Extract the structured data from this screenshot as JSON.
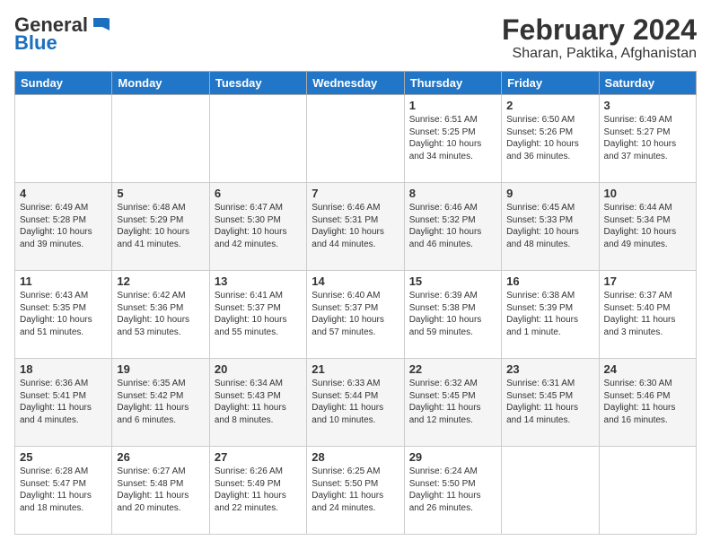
{
  "logo": {
    "general": "General",
    "blue": "Blue"
  },
  "title": "February 2024",
  "subtitle": "Sharan, Paktika, Afghanistan",
  "days": [
    "Sunday",
    "Monday",
    "Tuesday",
    "Wednesday",
    "Thursday",
    "Friday",
    "Saturday"
  ],
  "weeks": [
    [
      {
        "num": "",
        "info": ""
      },
      {
        "num": "",
        "info": ""
      },
      {
        "num": "",
        "info": ""
      },
      {
        "num": "",
        "info": ""
      },
      {
        "num": "1",
        "info": "Sunrise: 6:51 AM\nSunset: 5:25 PM\nDaylight: 10 hours and 34 minutes."
      },
      {
        "num": "2",
        "info": "Sunrise: 6:50 AM\nSunset: 5:26 PM\nDaylight: 10 hours and 36 minutes."
      },
      {
        "num": "3",
        "info": "Sunrise: 6:49 AM\nSunset: 5:27 PM\nDaylight: 10 hours and 37 minutes."
      }
    ],
    [
      {
        "num": "4",
        "info": "Sunrise: 6:49 AM\nSunset: 5:28 PM\nDaylight: 10 hours and 39 minutes."
      },
      {
        "num": "5",
        "info": "Sunrise: 6:48 AM\nSunset: 5:29 PM\nDaylight: 10 hours and 41 minutes."
      },
      {
        "num": "6",
        "info": "Sunrise: 6:47 AM\nSunset: 5:30 PM\nDaylight: 10 hours and 42 minutes."
      },
      {
        "num": "7",
        "info": "Sunrise: 6:46 AM\nSunset: 5:31 PM\nDaylight: 10 hours and 44 minutes."
      },
      {
        "num": "8",
        "info": "Sunrise: 6:46 AM\nSunset: 5:32 PM\nDaylight: 10 hours and 46 minutes."
      },
      {
        "num": "9",
        "info": "Sunrise: 6:45 AM\nSunset: 5:33 PM\nDaylight: 10 hours and 48 minutes."
      },
      {
        "num": "10",
        "info": "Sunrise: 6:44 AM\nSunset: 5:34 PM\nDaylight: 10 hours and 49 minutes."
      }
    ],
    [
      {
        "num": "11",
        "info": "Sunrise: 6:43 AM\nSunset: 5:35 PM\nDaylight: 10 hours and 51 minutes."
      },
      {
        "num": "12",
        "info": "Sunrise: 6:42 AM\nSunset: 5:36 PM\nDaylight: 10 hours and 53 minutes."
      },
      {
        "num": "13",
        "info": "Sunrise: 6:41 AM\nSunset: 5:37 PM\nDaylight: 10 hours and 55 minutes."
      },
      {
        "num": "14",
        "info": "Sunrise: 6:40 AM\nSunset: 5:37 PM\nDaylight: 10 hours and 57 minutes."
      },
      {
        "num": "15",
        "info": "Sunrise: 6:39 AM\nSunset: 5:38 PM\nDaylight: 10 hours and 59 minutes."
      },
      {
        "num": "16",
        "info": "Sunrise: 6:38 AM\nSunset: 5:39 PM\nDaylight: 11 hours and 1 minute."
      },
      {
        "num": "17",
        "info": "Sunrise: 6:37 AM\nSunset: 5:40 PM\nDaylight: 11 hours and 3 minutes."
      }
    ],
    [
      {
        "num": "18",
        "info": "Sunrise: 6:36 AM\nSunset: 5:41 PM\nDaylight: 11 hours and 4 minutes."
      },
      {
        "num": "19",
        "info": "Sunrise: 6:35 AM\nSunset: 5:42 PM\nDaylight: 11 hours and 6 minutes."
      },
      {
        "num": "20",
        "info": "Sunrise: 6:34 AM\nSunset: 5:43 PM\nDaylight: 11 hours and 8 minutes."
      },
      {
        "num": "21",
        "info": "Sunrise: 6:33 AM\nSunset: 5:44 PM\nDaylight: 11 hours and 10 minutes."
      },
      {
        "num": "22",
        "info": "Sunrise: 6:32 AM\nSunset: 5:45 PM\nDaylight: 11 hours and 12 minutes."
      },
      {
        "num": "23",
        "info": "Sunrise: 6:31 AM\nSunset: 5:45 PM\nDaylight: 11 hours and 14 minutes."
      },
      {
        "num": "24",
        "info": "Sunrise: 6:30 AM\nSunset: 5:46 PM\nDaylight: 11 hours and 16 minutes."
      }
    ],
    [
      {
        "num": "25",
        "info": "Sunrise: 6:28 AM\nSunset: 5:47 PM\nDaylight: 11 hours and 18 minutes."
      },
      {
        "num": "26",
        "info": "Sunrise: 6:27 AM\nSunset: 5:48 PM\nDaylight: 11 hours and 20 minutes."
      },
      {
        "num": "27",
        "info": "Sunrise: 6:26 AM\nSunset: 5:49 PM\nDaylight: 11 hours and 22 minutes."
      },
      {
        "num": "28",
        "info": "Sunrise: 6:25 AM\nSunset: 5:50 PM\nDaylight: 11 hours and 24 minutes."
      },
      {
        "num": "29",
        "info": "Sunrise: 6:24 AM\nSunset: 5:50 PM\nDaylight: 11 hours and 26 minutes."
      },
      {
        "num": "",
        "info": ""
      },
      {
        "num": "",
        "info": ""
      }
    ]
  ]
}
